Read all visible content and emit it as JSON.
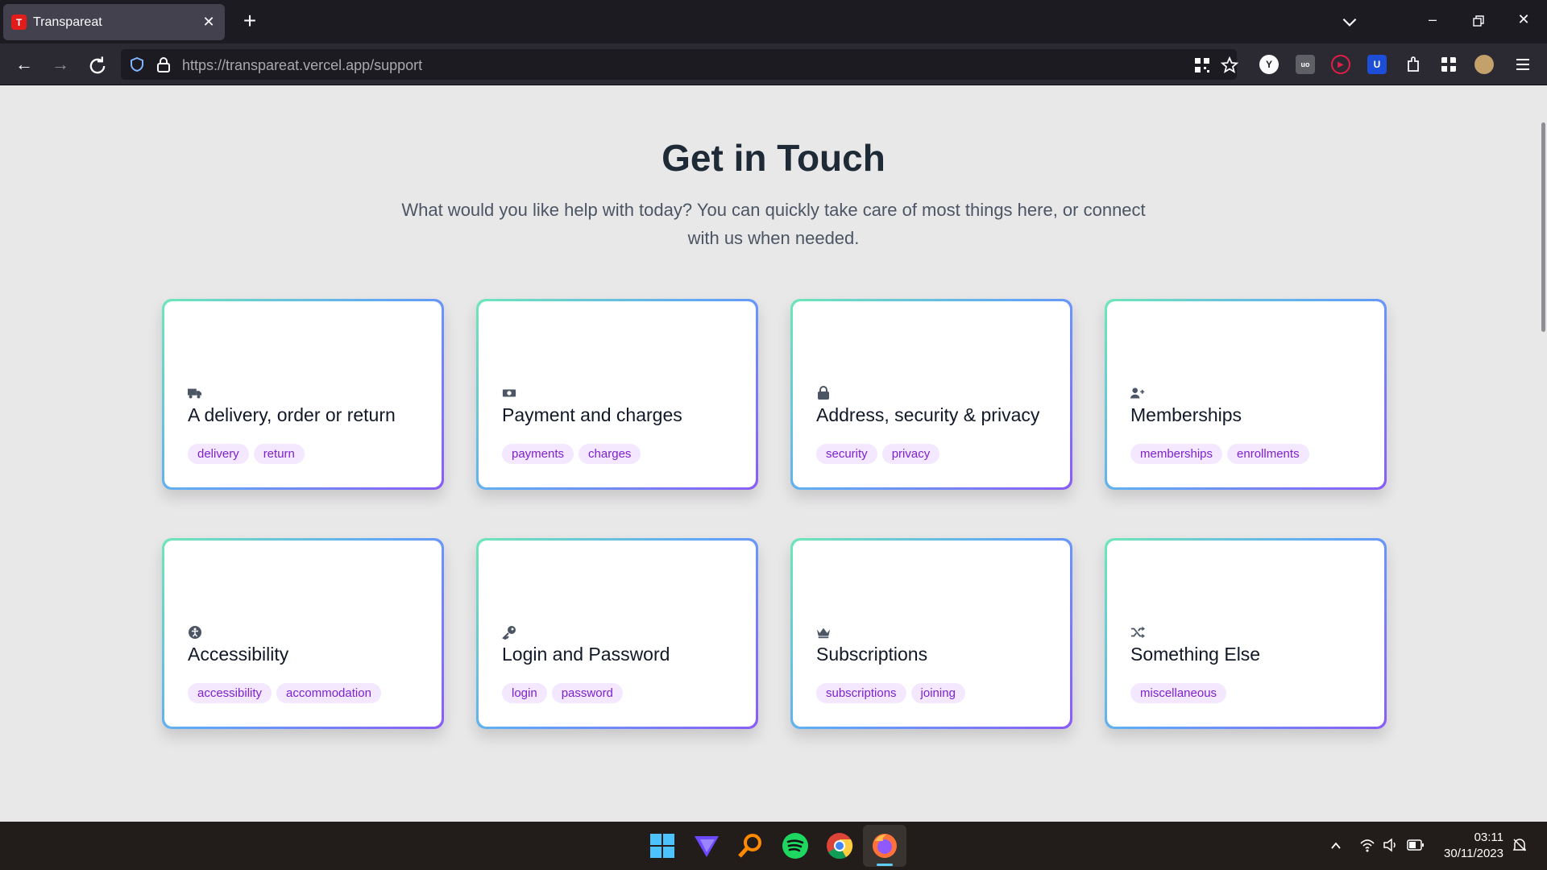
{
  "browser": {
    "tab_title": "Transpareat",
    "tab_favicon_letter": "T",
    "url_host": "https://transpareat.vercel.app",
    "url_path": "/support",
    "extensions": [
      {
        "name": "yomichan",
        "letter": "Y",
        "color": "#ffffff"
      },
      {
        "name": "ublock",
        "letter": "uo",
        "color": "#5f5f66"
      },
      {
        "name": "video-ext",
        "letter": "▶",
        "color": "#e11d48"
      },
      {
        "name": "bitwarden",
        "letter": "U",
        "color": "#1d4ed8"
      }
    ]
  },
  "page": {
    "heading": "Get in Touch",
    "subtitle": "What would you like help with today? You can quickly take care of most things here, or connect with us when needed.",
    "cards": [
      {
        "icon": "truck-icon",
        "title": "A delivery, order or return",
        "tags": [
          "delivery",
          "return"
        ]
      },
      {
        "icon": "money-bill-icon",
        "title": "Payment and charges",
        "tags": [
          "payments",
          "charges"
        ]
      },
      {
        "icon": "lock-icon",
        "title": "Address, security & privacy",
        "tags": [
          "security",
          "privacy"
        ]
      },
      {
        "icon": "user-plus-icon",
        "title": "Memberships",
        "tags": [
          "memberships",
          "enrollments"
        ]
      },
      {
        "icon": "accessibility-icon",
        "title": "Accessibility",
        "tags": [
          "accessibility",
          "accommodation"
        ]
      },
      {
        "icon": "key-icon",
        "title": "Login and Password",
        "tags": [
          "login",
          "password"
        ]
      },
      {
        "icon": "crown-icon",
        "title": "Subscriptions",
        "tags": [
          "subscriptions",
          "joining"
        ]
      },
      {
        "icon": "shuffle-icon",
        "title": "Something Else",
        "tags": [
          "miscellaneous"
        ]
      }
    ]
  },
  "taskbar": {
    "time": "03:11",
    "date": "30/11/2023",
    "apps": [
      "start",
      "proton-vpn",
      "search-everything",
      "spotify",
      "chrome",
      "firefox"
    ]
  },
  "colors": {
    "heading": "#1f2a37",
    "tag_bg": "#f3e8ff",
    "tag_text": "#7e22ce",
    "card_gradient_start": "#6ee7b7",
    "card_gradient_end": "#8b5cf6"
  }
}
